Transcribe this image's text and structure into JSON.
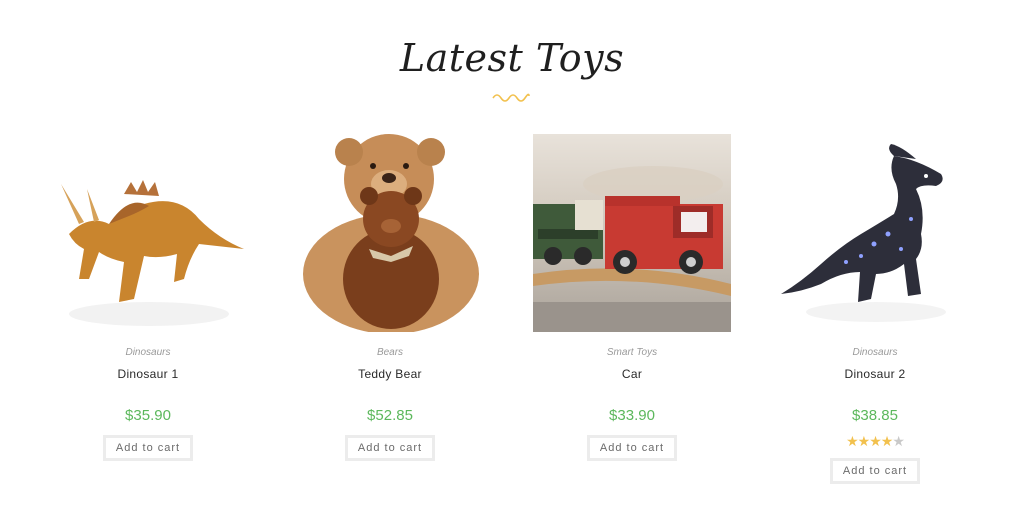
{
  "section": {
    "title": "Latest Toys"
  },
  "products": [
    {
      "category": "Dinosaurs",
      "name": "Dinosaur 1",
      "price": "$35.90",
      "button": "Add to cart"
    },
    {
      "category": "Bears",
      "name": "Teddy Bear",
      "price": "$52.85",
      "button": "Add to cart"
    },
    {
      "category": "Smart Toys",
      "name": "Car",
      "price": "$33.90",
      "button": "Add to cart"
    },
    {
      "category": "Dinosaurs",
      "name": "Dinosaur 2",
      "price": "$38.85",
      "button": "Add to cart",
      "rating": 4,
      "rating_max": 5
    }
  ],
  "colors": {
    "price": "#5cb85c",
    "accent": "#f2c14e"
  }
}
